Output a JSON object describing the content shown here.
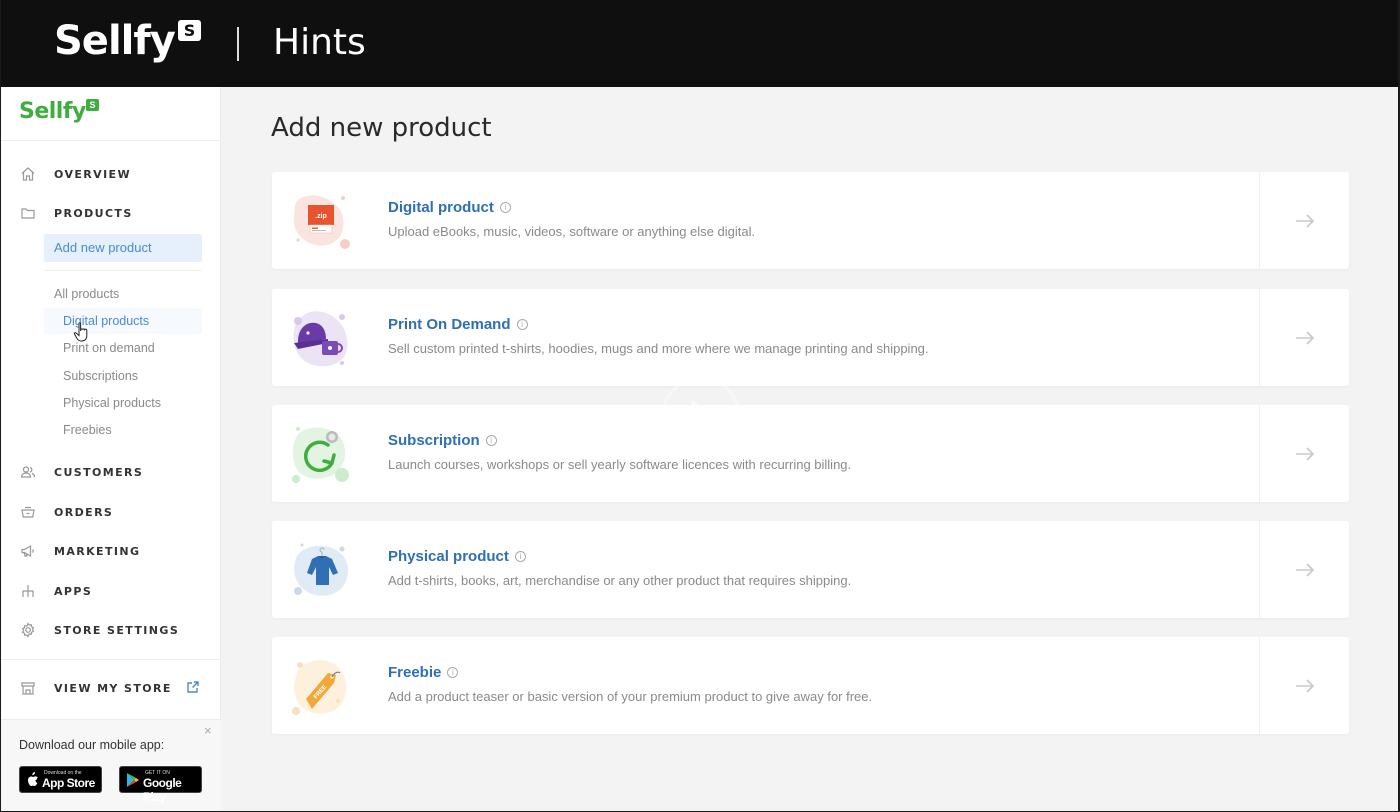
{
  "banner": {
    "brand": "Sellfy",
    "brand_badge": "S",
    "title": "Hints"
  },
  "sidebar": {
    "logo": "Sellfy",
    "logo_badge": "S",
    "nav": [
      {
        "label": "OVERVIEW",
        "icon": "home-icon"
      },
      {
        "label": "PRODUCTS",
        "icon": "folder-icon"
      },
      {
        "label": "CUSTOMERS",
        "icon": "users-icon"
      },
      {
        "label": "ORDERS",
        "icon": "basket-icon"
      },
      {
        "label": "MARKETING",
        "icon": "megaphone-icon"
      },
      {
        "label": "APPS",
        "icon": "apps-hierarchy-icon"
      },
      {
        "label": "STORE SETTINGS",
        "icon": "gear-icon"
      },
      {
        "label": "VIEW MY STORE",
        "icon": "storefront-icon"
      }
    ],
    "products_sub": {
      "add_new": "Add new product",
      "all_products": "All products",
      "items": [
        "Digital products",
        "Print on demand",
        "Subscriptions",
        "Physical products",
        "Freebies"
      ]
    },
    "promo": {
      "text": "Download our mobile app:",
      "close": "×",
      "app_store_small": "Download on the",
      "app_store": "App Store",
      "google_play_small": "GET IT ON",
      "google_play": "Google Play"
    }
  },
  "main": {
    "title": "Add new product",
    "info_glyph": "i",
    "cards": [
      {
        "title": "Digital product",
        "desc": "Upload eBooks, music, videos, software or anything else digital.",
        "art": "zip-file-illustration",
        "color": "#e8532f"
      },
      {
        "title": "Print On Demand",
        "desc": "Sell custom printed t-shirts, hoodies, mugs and more where we manage printing and shipping.",
        "art": "cap-and-mug-illustration",
        "color": "#6a3aa8"
      },
      {
        "title": "Subscription",
        "desc": "Launch courses, workshops or sell yearly software licences with recurring billing.",
        "art": "recurring-arrow-illustration",
        "color": "#3fae3f"
      },
      {
        "title": "Physical product",
        "desc": "Add t-shirts, books, art, merchandise or any other product that requires shipping.",
        "art": "shirt-illustration",
        "color": "#2f6fb3"
      },
      {
        "title": "Freebie",
        "desc": "Add a product teaser or basic version of your premium product to give away for free.",
        "art": "free-tag-illustration",
        "color": "#f0a83a"
      }
    ]
  },
  "colors": {
    "brand_green": "#3fae3f",
    "link_blue": "#2f6fb3",
    "active_bg": "#e6f0fb"
  }
}
